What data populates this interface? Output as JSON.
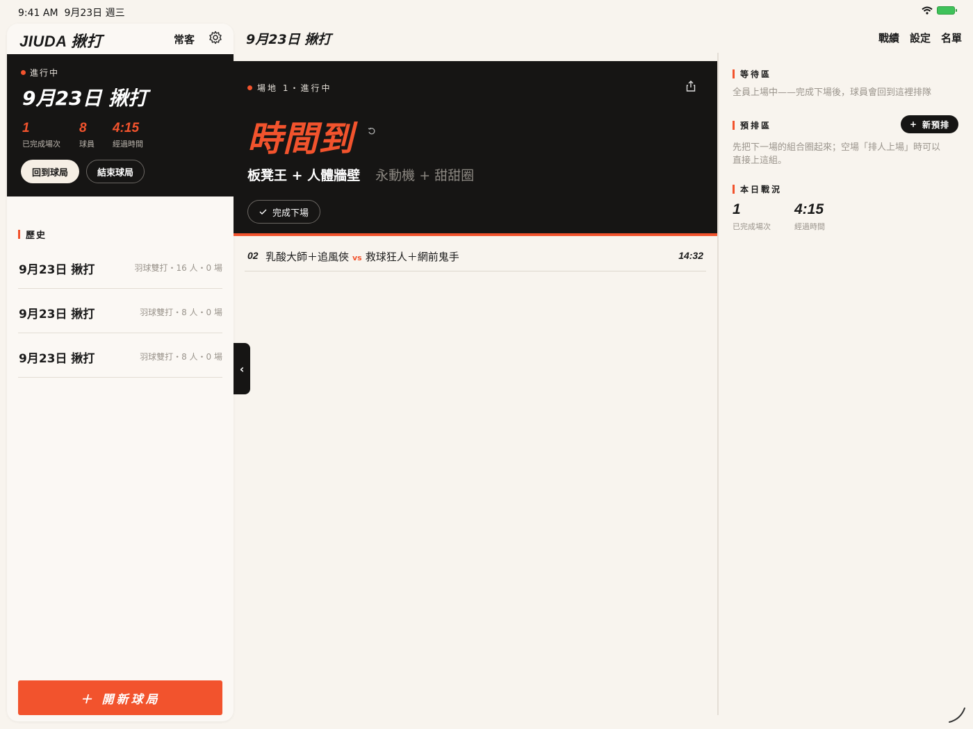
{
  "status_bar": {
    "time": "9:41 AM",
    "date": "9月23日 週三"
  },
  "sidebar": {
    "brand": "JIUDA 揪打",
    "regulars_label": "常客",
    "live_label": "進行中",
    "session_title": "9月23日 揪打",
    "stats": [
      {
        "value": "1",
        "label": "已完成場次"
      },
      {
        "value": "8",
        "label": "球員"
      },
      {
        "value": "4:15",
        "label": "經過時間"
      }
    ],
    "return_button": "回到球局",
    "end_button": "結束球局",
    "history_heading": "歷史",
    "history": [
      {
        "title": "9月23日 揪打",
        "meta": "羽球雙打・16 人・0 場"
      },
      {
        "title": "9月23日 揪打",
        "meta": "羽球雙打・8 人・0 場"
      },
      {
        "title": "9月23日 揪打",
        "meta": "羽球雙打・8 人・0 場"
      }
    ],
    "new_session_button": "＋ 開新球局"
  },
  "main": {
    "title": "9月23日 揪打",
    "nav": [
      "戰績",
      "設定",
      "名單"
    ],
    "court": {
      "status": "場地 1・進行中",
      "headline": "時間到",
      "team_a": "板凳王 + 人體牆壁",
      "team_b": "永動機 + 甜甜圈",
      "done_button": "完成下場"
    },
    "queue": [
      {
        "number": "02",
        "team_a": "乳酸大師＋追風俠",
        "vs": "vs",
        "team_b": "救球狂人＋網前鬼手",
        "time": "14:32"
      }
    ],
    "collapse_glyph": "‹"
  },
  "right_panel": {
    "waiting_heading": "等待區",
    "waiting_text": "全員上場中——完成下場後，球員會回到這裡排隊",
    "prebook_heading": "預排區",
    "prebook_button": "新預排",
    "prebook_text": "先把下一場的組合圈起來；空場「排人上場」時可以直接上這組。",
    "today_heading": "本日戰況",
    "today_stats": [
      {
        "value": "1",
        "label": "已完成場次"
      },
      {
        "value": "4:15",
        "label": "經過時間"
      }
    ]
  },
  "icons": {
    "settings": "gear-icon",
    "share": "share-icon",
    "reset": "reset-icon",
    "check": "check-icon",
    "plus": "plus-icon",
    "wifi": "wifi-icon",
    "battery": "battery-icon"
  },
  "colors": {
    "accent": "#f2532d",
    "dark": "#161514",
    "background": "#f8f4ee"
  }
}
